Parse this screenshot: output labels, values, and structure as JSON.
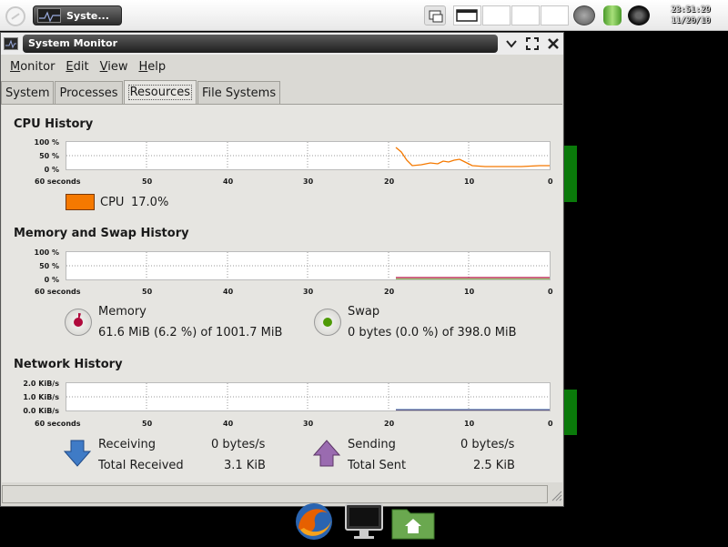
{
  "panel": {
    "task_button_label": "Syste...",
    "clock_time": "23:51:29",
    "clock_date": "11/20/10"
  },
  "window": {
    "title": "System Monitor",
    "menu": [
      "Monitor",
      "Edit",
      "View",
      "Help"
    ],
    "tabs": [
      "System",
      "Processes",
      "Resources",
      "File Systems"
    ],
    "active_tab": "Resources"
  },
  "cpu": {
    "title": "CPU History",
    "y_ticks": [
      "100 %",
      "50 %",
      "0 %"
    ],
    "x_ticks": [
      "60 seconds",
      "50",
      "40",
      "30",
      "20",
      "10",
      "0"
    ],
    "legend_label": "CPU",
    "legend_value": "17.0%",
    "color": "#f57900"
  },
  "memory": {
    "title": "Memory and Swap History",
    "y_ticks": [
      "100 %",
      "50 %",
      "0 %"
    ],
    "x_ticks": [
      "60 seconds",
      "50",
      "40",
      "30",
      "20",
      "10",
      "0"
    ],
    "memory_label": "Memory",
    "memory_value": "61.6 MiB (6.2 %) of 1001.7 MiB",
    "memory_color": "#b00a3c",
    "swap_label": "Swap",
    "swap_value": "0 bytes (0.0 %) of 398.0 MiB",
    "swap_color": "#4e9a06"
  },
  "network": {
    "title": "Network History",
    "y_ticks": [
      "2.0 KiB/s",
      "1.0 KiB/s",
      "0.0 KiB/s"
    ],
    "x_ticks": [
      "60 seconds",
      "50",
      "40",
      "30",
      "20",
      "10",
      "0"
    ],
    "receiving_label": "Receiving",
    "receiving_value": "0 bytes/s",
    "total_received_label": "Total Received",
    "total_received_value": "3.1 KiB",
    "sending_label": "Sending",
    "sending_value": "0 bytes/s",
    "total_sent_label": "Total Sent",
    "total_sent_value": "2.5 KiB",
    "receive_color": "#3465a4",
    "send_color": "#75507b"
  }
}
